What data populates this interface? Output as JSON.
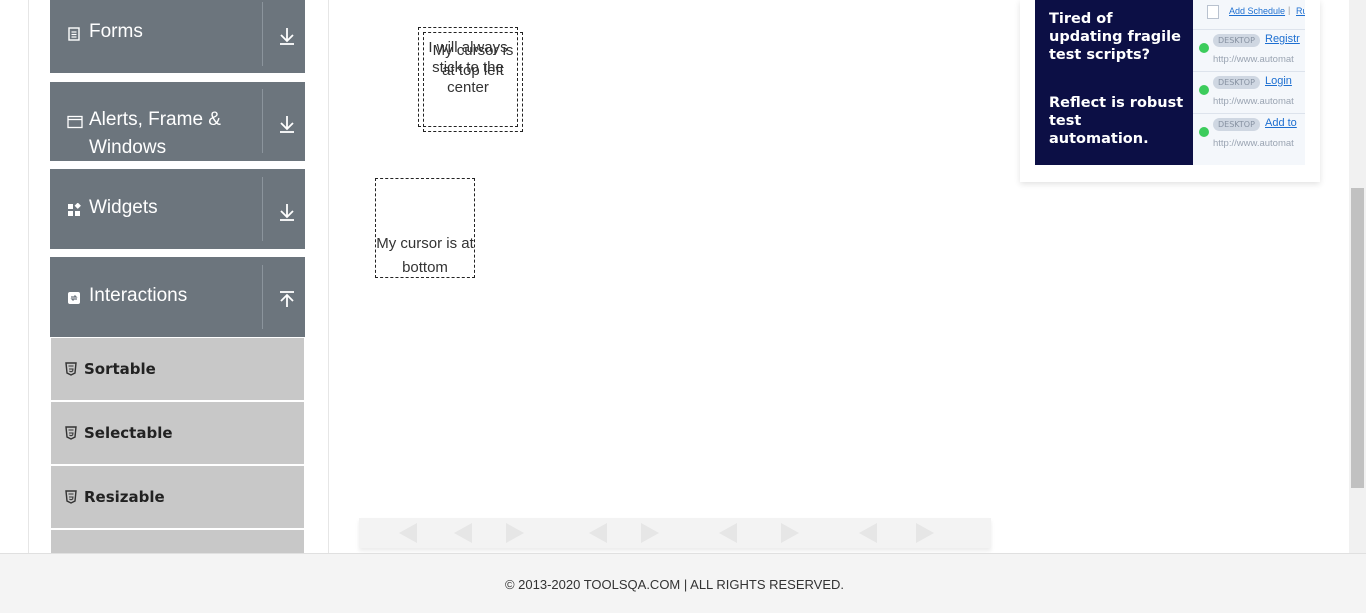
{
  "sidebar": {
    "groups": [
      {
        "label": "Forms",
        "icon": "document-icon",
        "arrow": "down"
      },
      {
        "label": "Alerts, Frame & Windows",
        "label_line1": "Alerts, Frame &",
        "label_line2": "Windows",
        "icon": "window-icon",
        "arrow": "down"
      },
      {
        "label": "Widgets",
        "icon": "widgets-icon",
        "arrow": "down"
      },
      {
        "label": "Interactions",
        "icon": "interactions-icon",
        "arrow": "up"
      }
    ],
    "items": [
      {
        "label": "Sortable",
        "icon": "html5-icon"
      },
      {
        "label": "Selectable",
        "icon": "html5-icon"
      },
      {
        "label": "Resizable",
        "icon": "html5-icon"
      }
    ]
  },
  "main": {
    "box_top_left_back": "I will always stick to the center",
    "box_top_left_front": "My cursor is at top left",
    "box_bottom": "My cursor is at bottom"
  },
  "ad": {
    "headline": "Tired of updating fragile test scripts?",
    "tagline": "Reflect is robust test automation.",
    "header_link": "Add Schedule",
    "header_more": "Ru",
    "rows": [
      {
        "badge": "DESKTOP",
        "link": "Registr",
        "url": "http://www.automat"
      },
      {
        "badge": "DESKTOP",
        "link": "Login",
        "url": "http://www.automat"
      },
      {
        "badge": "DESKTOP",
        "link": "Add to",
        "url": "http://www.automat"
      }
    ],
    "colors": {
      "dark_bg": "#0c0f45",
      "link": "#1d6fd1",
      "status_ok": "#3ccc5c"
    }
  },
  "footer": {
    "copyright": "© 2013-2020 TOOLSQA.COM | ALL RIGHTS RESERVED."
  },
  "colors": {
    "group_header_bg": "#6c757d",
    "item_bg": "#c8c8c8",
    "footer_bg": "#f4f4f4"
  }
}
